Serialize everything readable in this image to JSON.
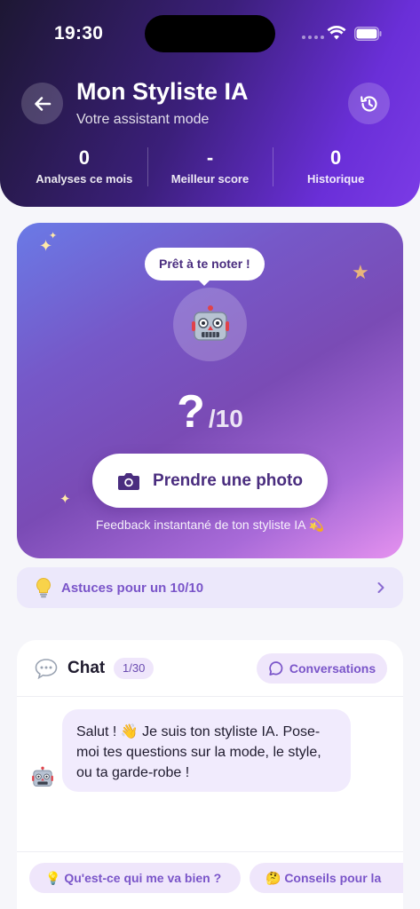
{
  "status_bar": {
    "time": "19:30"
  },
  "header": {
    "title": "Mon Styliste IA",
    "subtitle": "Votre assistant mode",
    "back_icon": "arrow-left-icon",
    "history_icon": "history-icon",
    "stats": [
      {
        "value": "0",
        "label": "Analyses ce mois"
      },
      {
        "value": "-",
        "label": "Meilleur score"
      },
      {
        "value": "0",
        "label": "Historique"
      }
    ]
  },
  "hero": {
    "bubble": "Prêt à te noter !",
    "avatar_icon": "robot-icon",
    "score_value": "?",
    "score_max": "/10",
    "photo_button": "Prendre une photo",
    "footer": "Feedback instantané de ton styliste IA 💫"
  },
  "tips": {
    "icon": "lightbulb-icon",
    "label": "Astuces pour un 10/10"
  },
  "chat": {
    "title": "Chat",
    "count": "1/30",
    "conversations_button": "Conversations",
    "message": "Salut ! 👋 Je suis ton styliste IA. Pose-moi tes questions sur la mode, le style, ou ta garde-robe !",
    "chips": [
      "💡 Qu'est-ce qui me va bien ?",
      "🤔 Conseils pour la"
    ]
  },
  "colors": {
    "header_start": "#1d1733",
    "header_end": "#7b3be6",
    "accent": "#7a55c9",
    "accent_dark": "#4a2d7f",
    "chip_bg": "#efe6fb"
  }
}
